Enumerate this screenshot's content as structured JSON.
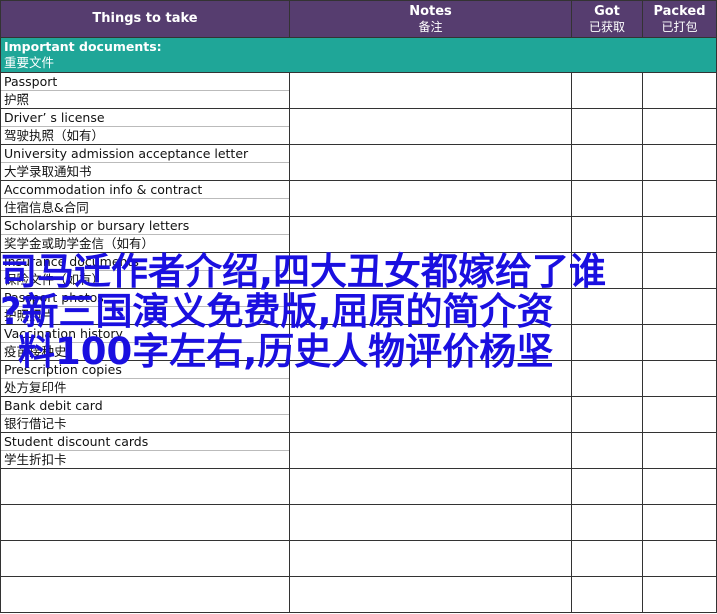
{
  "header": {
    "things": "Things to take",
    "notes_en": "Notes",
    "notes_zh": "备注",
    "got_en": "Got",
    "got_zh": "已获取",
    "packed_en": "Packed",
    "packed_zh": "已打包"
  },
  "section": {
    "title_en": "Important documents:",
    "title_zh": "重要文件"
  },
  "items": [
    {
      "en": "Passport",
      "zh": "护照"
    },
    {
      "en": "Driver’ s license",
      "zh": "驾驶执照（如有）"
    },
    {
      "en": "University admission acceptance letter",
      "zh": "大学录取通知书"
    },
    {
      "en": "Accommodation info & contract",
      "zh": "住宿信息&合同"
    },
    {
      "en": "Scholarship or bursary letters",
      "zh": "奖学金或助学金信（如有）"
    },
    {
      "en": "Insurance documents",
      "zh": "保险文件（如有）"
    },
    {
      "en": "Passport photos",
      "zh": "护照照片"
    },
    {
      "en": "Vaccination history",
      "zh": "疫苗接种史"
    },
    {
      "en": "Prescription copies",
      "zh": "处方复印件"
    },
    {
      "en": "Bank debit card",
      "zh": "银行借记卡"
    },
    {
      "en": "Student discount cards",
      "zh": "学生折扣卡"
    }
  ],
  "overlay": {
    "line1": "司马迁作者介绍,四大丑女都嫁给了谁",
    "line2": "?新三国演义免费版,屈原的简介资",
    "line3": "料100字左右,历史人物评价杨坚"
  }
}
